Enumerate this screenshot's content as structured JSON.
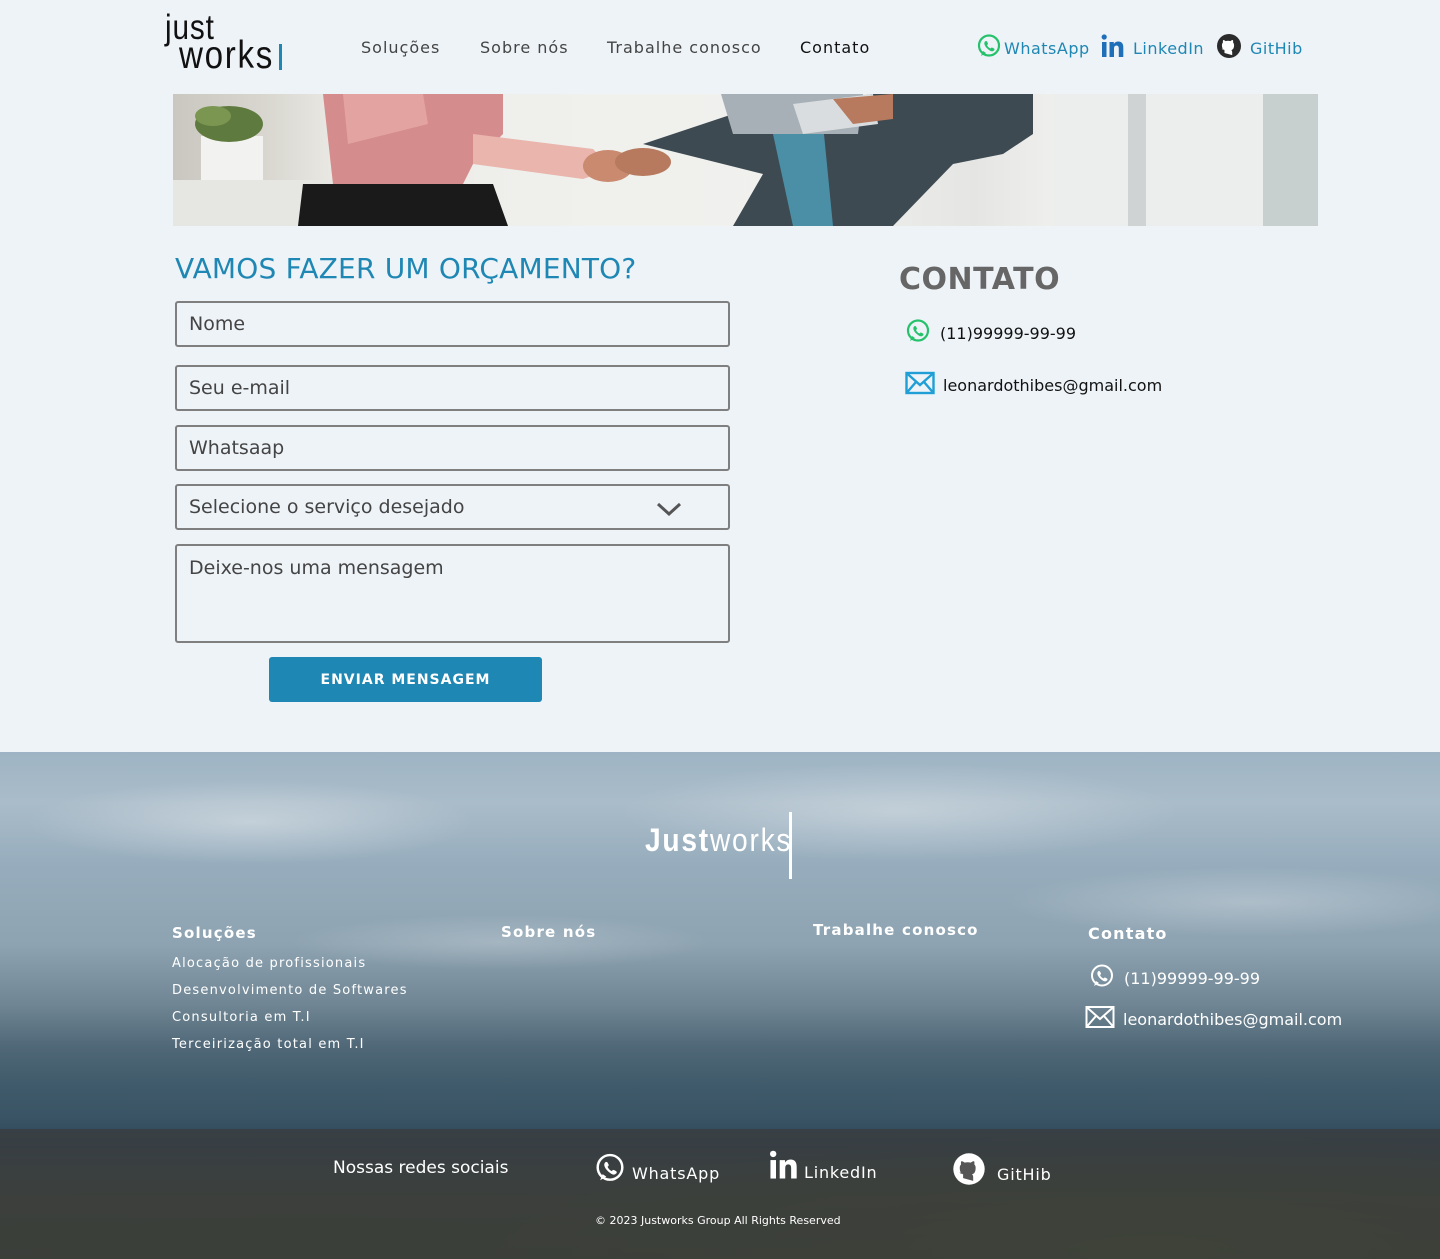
{
  "logo": {
    "line1": "just",
    "line2": "works"
  },
  "nav": {
    "items": [
      {
        "label": "Soluções"
      },
      {
        "label": "Sobre nós"
      },
      {
        "label": "Trabalhe conosco"
      },
      {
        "label": "Contato"
      }
    ]
  },
  "social_top": {
    "whatsapp": "WhatsApp",
    "linkedin": "LinkedIn",
    "github": "GitHib"
  },
  "form": {
    "title": "VAMOS FAZER UM ORÇAMENTO?",
    "name_placeholder": "Nome",
    "email_placeholder": "Seu e-mail",
    "whatsapp_placeholder": "Whatsaap",
    "service_select": "Selecione o serviço desejado",
    "message_placeholder": "Deixe-nos uma mensagem",
    "submit_label": "ENVIAR MENSAGEM"
  },
  "contact": {
    "title": "CONTATO",
    "phone": "(11)99999-99-99",
    "email": "leonardothibes@gmail.com"
  },
  "footer": {
    "logo_bold": "Just",
    "logo_light": "works",
    "columns": {
      "solucoes": {
        "title": "Soluções",
        "links": [
          "Alocação de profissionais",
          "Desenvolvimento de Softwares",
          "Consultoria em T.I",
          "Terceirização total em T.I"
        ]
      },
      "sobre": {
        "title": "Sobre nós"
      },
      "trabalhe": {
        "title": "Trabalhe conosco"
      },
      "contato": {
        "title": "Contato",
        "phone": "(11)99999-99-99",
        "email": "leonardothibes@gmail.com"
      }
    },
    "social_label": "Nossas redes sociais",
    "social": {
      "whatsapp": "WhatsApp",
      "linkedin": "LinkedIn",
      "github": "GitHib"
    },
    "copyright": "© 2023 Justworks Group  All Rights Reserved"
  },
  "colors": {
    "accent": "#1f87b3",
    "whatsapp_green": "#25c26b",
    "background": "#eef3f8"
  }
}
